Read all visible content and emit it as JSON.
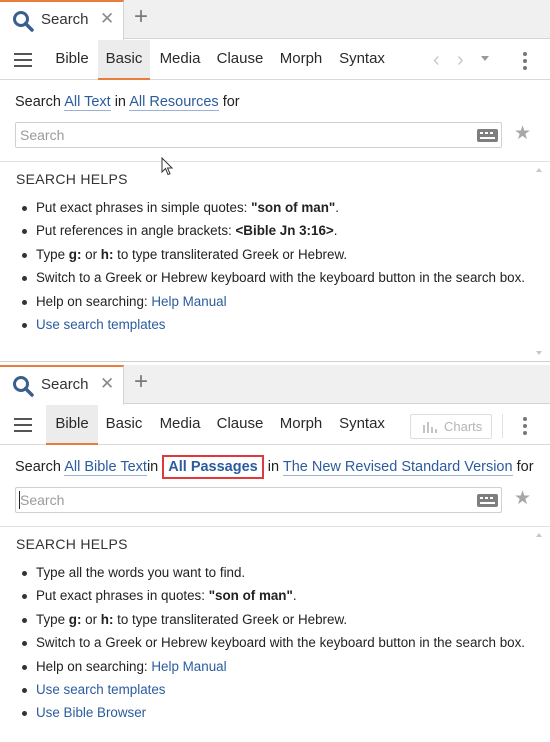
{
  "panels": [
    {
      "tab": {
        "title": "Search",
        "close": "✕",
        "new_tab": "+"
      },
      "toolbar": {
        "tabs": [
          "Bible",
          "Basic",
          "Media",
          "Clause",
          "Morph",
          "Syntax"
        ],
        "active_tab": "Basic",
        "nav_prev": "‹",
        "nav_next": "›"
      },
      "search_line": {
        "prefix": "Search",
        "scope": "All Text",
        "in": "in",
        "resource": "All Resources",
        "suffix": "for"
      },
      "search_input": {
        "value": "",
        "placeholder": "Search"
      },
      "helps": {
        "title": "SEARCH HELPS",
        "items": [
          {
            "pre": "Put exact phrases in simple quotes: ",
            "bold": "\"son of man\"",
            "post": "."
          },
          {
            "pre": "Put references in angle brackets: ",
            "bold": "<Bible Jn 3:16>",
            "post": "."
          },
          {
            "pre": "Type ",
            "bold": "g:",
            "mid": " or ",
            "bold2": "h:",
            "post": " to type transliterated Greek or Hebrew."
          },
          {
            "pre": "Switch to a Greek or Hebrew keyboard with the keyboard button in the search box."
          },
          {
            "pre": "Help on searching: ",
            "link": "Help Manual"
          },
          {
            "link": "Use search templates"
          }
        ]
      }
    },
    {
      "tab": {
        "title": "Search",
        "close": "✕",
        "new_tab": "+"
      },
      "toolbar": {
        "tabs": [
          "Bible",
          "Basic",
          "Media",
          "Clause",
          "Morph",
          "Syntax"
        ],
        "active_tab": "Bible",
        "charts_label": "Charts"
      },
      "search_line": {
        "prefix": "Search",
        "scope": "All Bible Text",
        "in": "in",
        "passages": "All Passages",
        "in2": "in",
        "version": "The New Revised Standard Version",
        "suffix": "for"
      },
      "search_input": {
        "value": "",
        "placeholder": "Search"
      },
      "helps": {
        "title": "SEARCH HELPS",
        "items": [
          {
            "pre": "Type all the words you want to find."
          },
          {
            "pre": "Put exact phrases in quotes: ",
            "bold": "\"son of man\"",
            "post": "."
          },
          {
            "pre": "Type ",
            "bold": "g:",
            "mid": " or ",
            "bold2": "h:",
            "post": " to type transliterated Greek or Hebrew."
          },
          {
            "pre": "Switch to a Greek or Hebrew keyboard with the keyboard button in the search box."
          },
          {
            "pre": "Help on searching: ",
            "link": "Help Manual"
          },
          {
            "link": "Use search templates"
          },
          {
            "link": "Use Bible Browser"
          }
        ]
      }
    }
  ],
  "colors": {
    "accent": "#e97d3c",
    "link": "#2b5c9e",
    "highlight": "#e0393c"
  },
  "icons": [
    "search-icon",
    "close-icon",
    "plus-icon",
    "menu-icon",
    "keyboard-icon",
    "star-icon",
    "more-vertical-icon",
    "chart-icon",
    "mouse-cursor-icon"
  ]
}
